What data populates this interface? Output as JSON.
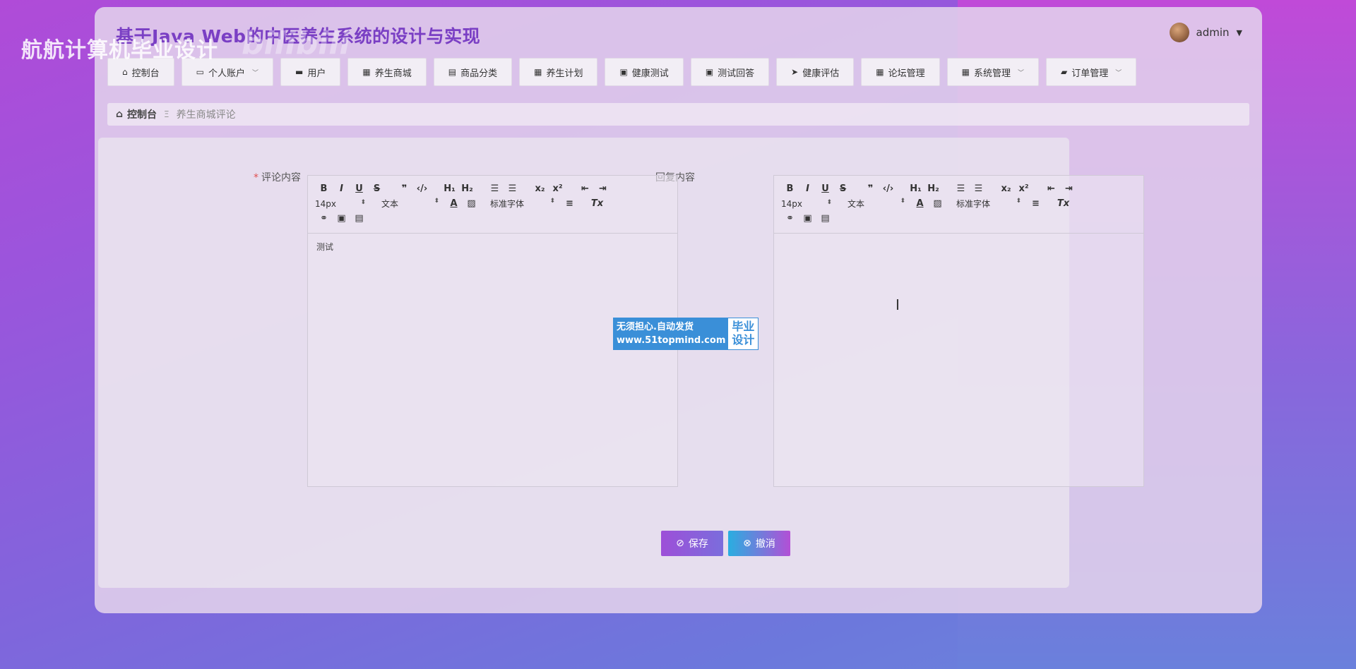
{
  "watermark": {
    "text": "航航计算机毕业设计",
    "bili": "bilibili"
  },
  "app": {
    "title": "基于Java Web的中医养生系统的设计与实现"
  },
  "user": {
    "name": "admin"
  },
  "nav": [
    {
      "label": "控制台",
      "icon": "home-icon",
      "glyph": "⌂",
      "dropdown": false
    },
    {
      "label": "个人账户",
      "icon": "card-icon",
      "glyph": "▭",
      "dropdown": true
    },
    {
      "label": "用户",
      "icon": "briefcase-icon",
      "glyph": "▬",
      "dropdown": false
    },
    {
      "label": "养生商城",
      "icon": "grid-icon",
      "glyph": "▦",
      "dropdown": false
    },
    {
      "label": "商品分类",
      "icon": "clipboard-icon",
      "glyph": "▤",
      "dropdown": false
    },
    {
      "label": "养生计划",
      "icon": "grid-icon",
      "glyph": "▦",
      "dropdown": false
    },
    {
      "label": "健康测试",
      "icon": "clipboard-x-icon",
      "glyph": "▣",
      "dropdown": false
    },
    {
      "label": "测试回答",
      "icon": "clipboard-check-icon",
      "glyph": "▣",
      "dropdown": false
    },
    {
      "label": "健康评估",
      "icon": "paper-plane-icon",
      "glyph": "➤",
      "dropdown": false
    },
    {
      "label": "论坛管理",
      "icon": "grid-icon",
      "glyph": "▦",
      "dropdown": false
    },
    {
      "label": "系统管理",
      "icon": "grid-icon",
      "glyph": "▦",
      "dropdown": true
    },
    {
      "label": "订单管理",
      "icon": "ticket-icon",
      "glyph": "▰",
      "dropdown": true
    }
  ],
  "breadcrumb": {
    "home": "控制台",
    "current": "养生商城评论"
  },
  "form": {
    "comment_label": "评论内容",
    "reply_label": "回复内容",
    "comment_value": "测试",
    "reply_value": ""
  },
  "editor": {
    "font_size": "14px",
    "block_type": "文本",
    "font_family": "标准字体"
  },
  "badge": {
    "line1": "无须担心.自动发货",
    "line2": "www.51topmind.com",
    "right1": "毕业",
    "right2": "设计"
  },
  "buttons": {
    "save": "保存",
    "cancel": "撤消"
  },
  "colors": {
    "accent": "#7a3fc4",
    "save": "#9d4fd8",
    "cancel": "#29aee0"
  }
}
